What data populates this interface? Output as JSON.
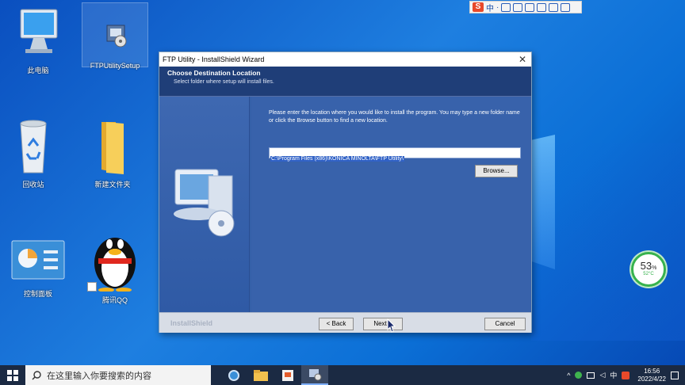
{
  "desktop": {
    "icons": [
      {
        "id": "this-pc",
        "label": "此电脑"
      },
      {
        "id": "ftp-setup",
        "label": "FTPUtilitySetup"
      },
      {
        "id": "recycle-bin",
        "label": "回收站"
      },
      {
        "id": "new-folder",
        "label": "新建文件夹"
      },
      {
        "id": "control-panel",
        "label": "控制面板"
      },
      {
        "id": "tencent-qq",
        "label": "腾讯QQ"
      }
    ]
  },
  "ime_toolbar": {
    "logo": "S",
    "mode": "中"
  },
  "network_widget": {
    "percent": "53",
    "percent_unit": "%",
    "temperature": "52°C"
  },
  "installer": {
    "title": "FTP Utility - InstallShield Wizard",
    "close_glyph": "✕",
    "header_title": "Choose Destination Location",
    "header_subtitle": "Select folder where setup will install files.",
    "description": "Please enter the location where you would like to install the program.  You may type a new folder name or click the Browse button to find a new location.",
    "install_path": "C:\\Program Files (x86)\\KONICA MINOLTA\\FTP Utility\\",
    "browse_label": "Browse...",
    "brand": "InstallShield",
    "back_label": "< Back",
    "next_label": "Next >",
    "cancel_label": "Cancel"
  },
  "taskbar": {
    "search_placeholder": "在这里输入你要搜索的内容",
    "tray_lang": "中",
    "time": "16:56",
    "date": "2022/4/22"
  },
  "colors": {
    "accent": "#1f3e78",
    "desktop": "#1e7fe0",
    "taskbar": "#1b2a43"
  }
}
